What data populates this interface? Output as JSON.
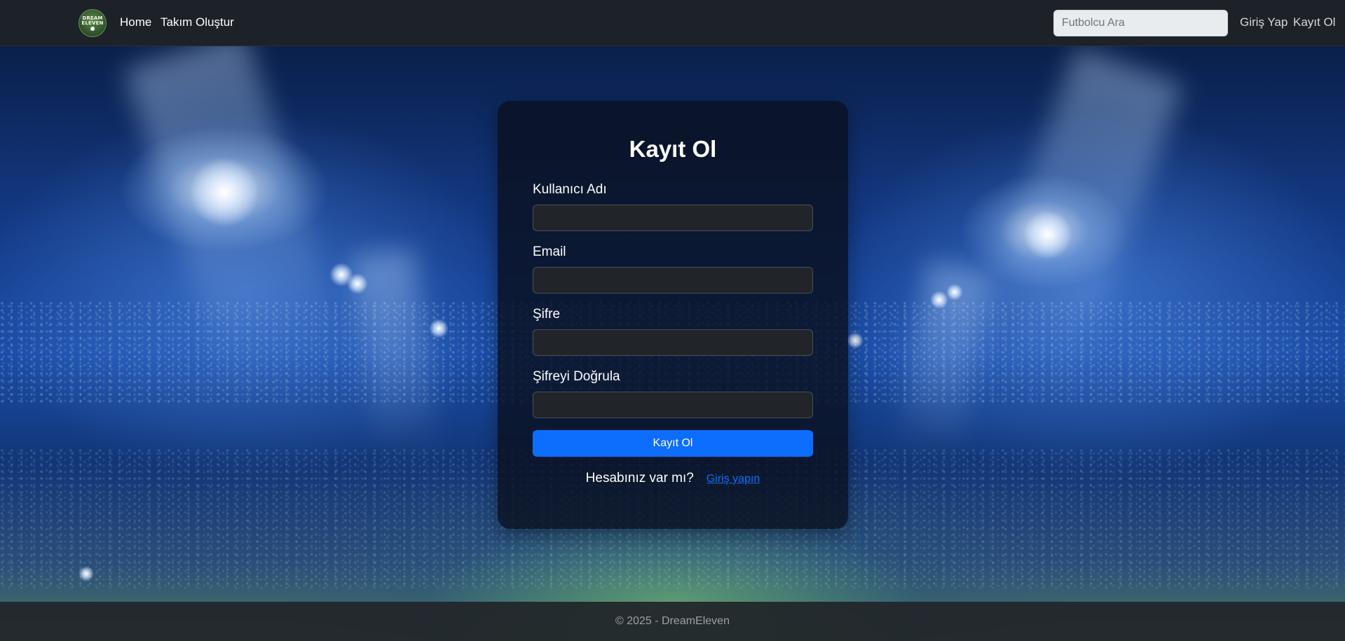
{
  "navbar": {
    "brand_logo_line1": "DREAM",
    "brand_logo_line2": "ELEVEN",
    "links": {
      "home": "Home",
      "create_team": "Takım Oluştur",
      "login": "Giriş Yap",
      "register": "Kayıt Ol"
    },
    "search": {
      "placeholder": "Futbolcu Ara",
      "value": ""
    }
  },
  "register_form": {
    "title": "Kayıt Ol",
    "fields": {
      "username_label": "Kullanıcı Adı",
      "email_label": "Email",
      "password_label": "Şifre",
      "confirm_password_label": "Şifreyi Doğrula"
    },
    "submit_label": "Kayıt Ol",
    "have_account_text": "Hesabınız var mı?",
    "login_link_text": "Giriş yapın"
  },
  "footer": {
    "copyright": "© 2025 - DreamEleven"
  },
  "colors": {
    "primary": "#0d6efd",
    "navbar_bg": "#1d2128",
    "input_bg": "#212529"
  }
}
